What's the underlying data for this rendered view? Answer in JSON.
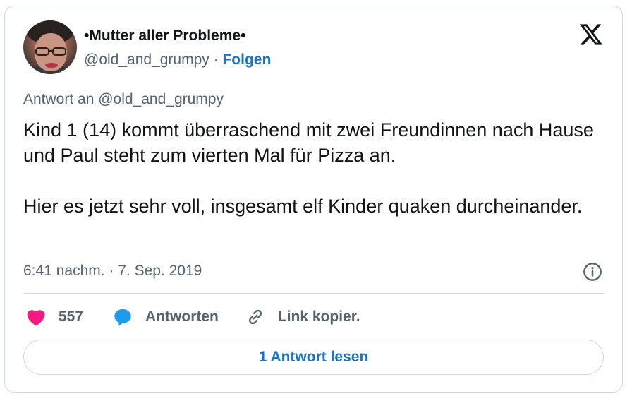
{
  "author": {
    "display_name": "•Mutter aller Probleme•",
    "handle": "@old_and_grumpy",
    "separator": "·",
    "follow_label": "Folgen"
  },
  "platform_icon": "x-logo-icon",
  "tweet": {
    "reply_to": "Antwort an @old_and_grumpy",
    "paragraphs": [
      "Kind 1 (14) kommt überraschend mit zwei Freundinnen nach Hause und Paul steht zum vierten Mal für Pizza an.",
      "Hier es jetzt sehr voll, insgesamt elf Kinder quaken durcheinander."
    ],
    "timestamp": "6:41 nachm. · 7. Sep. 2019"
  },
  "actions": {
    "like_count": "557",
    "reply_label": "Antworten",
    "copy_link_label": "Link kopier."
  },
  "read_replies_label": "1 Antwort lesen",
  "colors": {
    "heart": "#f91880",
    "reply_bubble": "#1d9bf0",
    "link_blue": "#1a73c8",
    "secondary_text": "#536471",
    "border": "#cfd9de"
  }
}
